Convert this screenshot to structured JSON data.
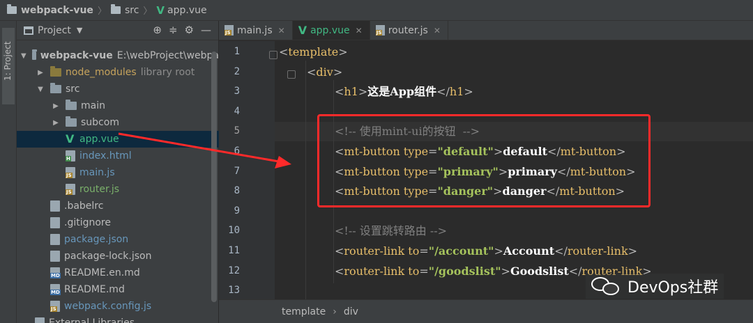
{
  "breadcrumb": {
    "project": "webpack-vue",
    "folder": "src",
    "file": "app.vue"
  },
  "strip": {
    "label": "1: Project"
  },
  "project_panel": {
    "title": "Project",
    "tree": [
      {
        "label": "webpack-vue",
        "extra": "E:\\webProject\\webpa",
        "kind": "folder",
        "expanded": true,
        "depth": 0
      },
      {
        "label": "node_modules",
        "extra": "library root",
        "kind": "folder-lib",
        "expanded": false,
        "depth": 1
      },
      {
        "label": "src",
        "extra": "",
        "kind": "folder",
        "expanded": true,
        "depth": 1
      },
      {
        "label": "main",
        "extra": "",
        "kind": "folder",
        "expanded": false,
        "depth": 2
      },
      {
        "label": "subcom",
        "extra": "",
        "kind": "folder",
        "expanded": false,
        "depth": 2
      },
      {
        "label": "app.vue",
        "extra": "",
        "kind": "vue",
        "depth": 2,
        "selected": true
      },
      {
        "label": "index.html",
        "extra": "",
        "kind": "html",
        "depth": 2
      },
      {
        "label": "main.js",
        "extra": "",
        "kind": "js",
        "depth": 2
      },
      {
        "label": "router.js",
        "extra": "",
        "kind": "js",
        "depth": 2
      },
      {
        "label": ".babelrc",
        "extra": "",
        "kind": "config",
        "depth": 1
      },
      {
        "label": ".gitignore",
        "extra": "",
        "kind": "config",
        "depth": 1
      },
      {
        "label": "package.json",
        "extra": "",
        "kind": "json",
        "depth": 1
      },
      {
        "label": "package-lock.json",
        "extra": "",
        "kind": "json",
        "depth": 1
      },
      {
        "label": "README.en.md",
        "extra": "",
        "kind": "md",
        "depth": 1
      },
      {
        "label": "README.md",
        "extra": "",
        "kind": "md",
        "depth": 1
      },
      {
        "label": "webpack.config.js",
        "extra": "",
        "kind": "js",
        "depth": 1
      },
      {
        "label": "External Libraries",
        "extra": "",
        "kind": "lib",
        "depth": 0
      }
    ]
  },
  "tabs": [
    {
      "label": "main.js",
      "kind": "js",
      "active": false
    },
    {
      "label": "app.vue",
      "kind": "vue",
      "active": true
    },
    {
      "label": "router.js",
      "kind": "js",
      "active": false
    }
  ],
  "code_lines": [
    {
      "n": "1",
      "text": "<template>"
    },
    {
      "n": "2",
      "text": "<div>"
    },
    {
      "n": "3",
      "text": "<h1>这是App组件</h1>"
    },
    {
      "n": "4",
      "text": ""
    },
    {
      "n": "5",
      "text": "<!-- 使用mint-ui的按钮  -->"
    },
    {
      "n": "6",
      "text": "<mt-button type=\"default\">default</mt-button>"
    },
    {
      "n": "7",
      "text": "<mt-button type=\"primary\">primary</mt-button>"
    },
    {
      "n": "8",
      "text": "<mt-button type=\"danger\">danger</mt-button>"
    },
    {
      "n": "9",
      "text": ""
    },
    {
      "n": "10",
      "text": "<!-- 设置跳转路由 -->"
    },
    {
      "n": "11",
      "text": "<router-link to=\"/account\">Account</router-link>"
    },
    {
      "n": "12",
      "text": "<router-link to=\"/goodslist\">Goodslist</router-link>"
    },
    {
      "n": "13",
      "text": ""
    }
  ],
  "status": {
    "crumb1": "template",
    "crumb2": "div"
  },
  "watermark": {
    "text": "DevOps社群"
  },
  "colors": {
    "accent_vue": "#41b883",
    "highlight_box": "#ff2a2a",
    "tag": "#e8bf6a",
    "string": "#a5c25c"
  }
}
